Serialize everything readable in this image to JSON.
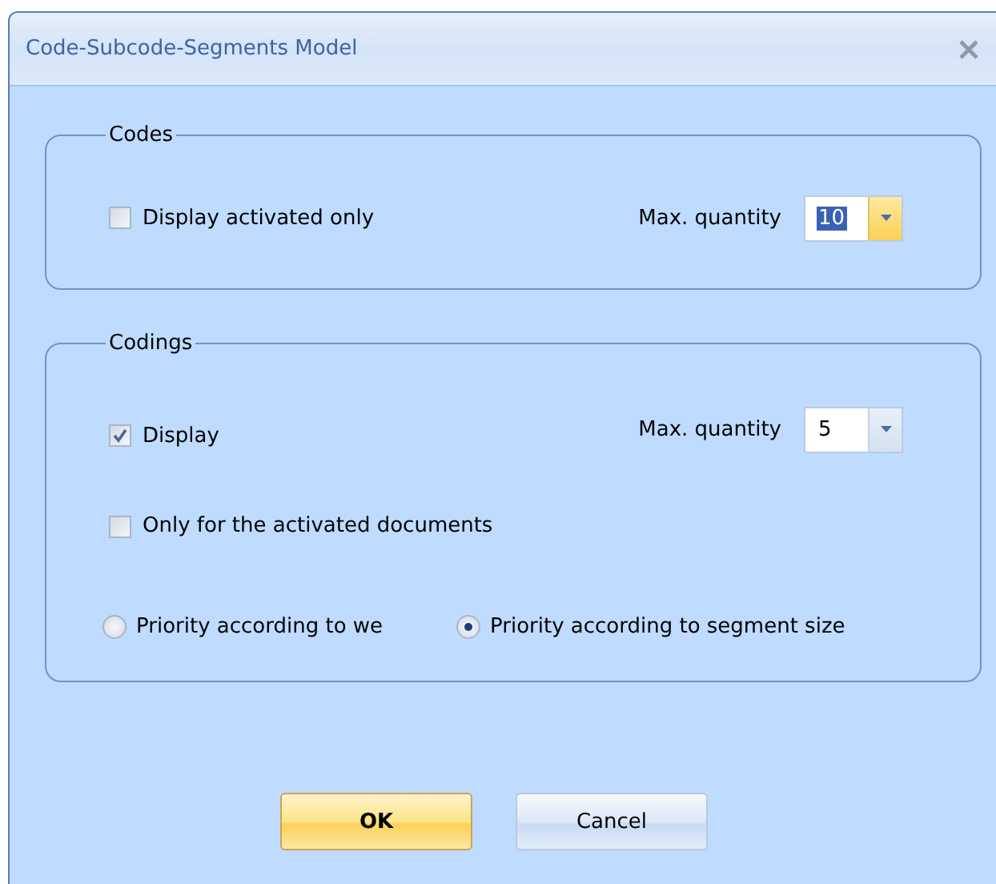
{
  "window": {
    "title": "Code-Subcode-Segments Model"
  },
  "codes": {
    "title": "Codes",
    "display_activated_only": {
      "label": "Display activated only",
      "checked": false
    },
    "max_quantity": {
      "label": "Max. quantity",
      "value": "10",
      "focused": true
    }
  },
  "codings": {
    "title": "Codings",
    "display": {
      "label": "Display",
      "checked": true
    },
    "max_quantity": {
      "label": "Max. quantity",
      "value": "5",
      "focused": false
    },
    "only_activated": {
      "label": "Only for the activated documents",
      "checked": false
    },
    "priority": [
      {
        "label": "Priority according to we",
        "selected": false
      },
      {
        "label": "Priority according to segment size",
        "selected": true
      }
    ]
  },
  "buttons": [
    {
      "label": "OK",
      "default": true
    },
    {
      "label": "Cancel",
      "default": false
    }
  ]
}
